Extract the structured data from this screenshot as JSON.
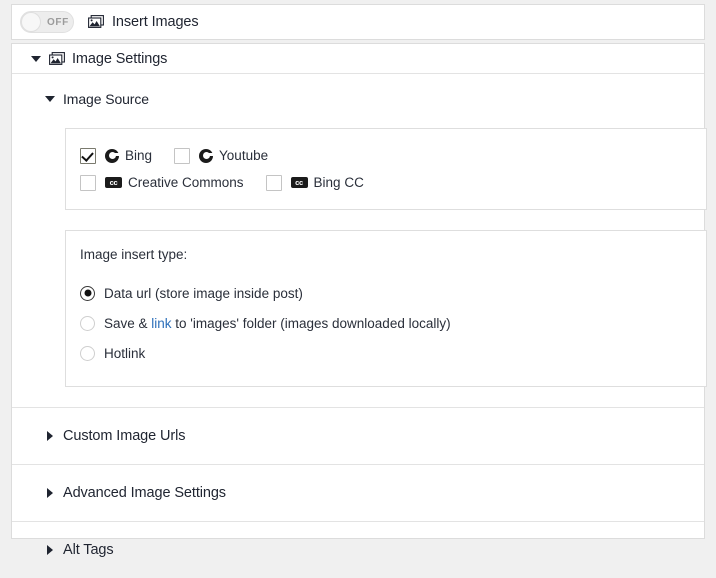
{
  "toggle": {
    "state_label": "OFF",
    "enabled": false,
    "icon": "image-icon",
    "title": "Insert Images"
  },
  "image_settings": {
    "title": "Image Settings",
    "icon": "image-icon",
    "expanded": true,
    "caret": "caret-down-icon"
  },
  "image_source": {
    "title": "Image Source",
    "expanded": true,
    "caret": "caret-down-icon",
    "sources": [
      {
        "label": "Bing",
        "checked": true,
        "icon": "bing-circle-icon"
      },
      {
        "label": "Youtube",
        "checked": false,
        "icon": "youtube-circle-icon"
      },
      {
        "label": "Creative Commons",
        "checked": false,
        "icon": "cc-badge-icon",
        "badge_text": "cc"
      },
      {
        "label": "Bing CC",
        "checked": false,
        "icon": "cc-badge-icon",
        "badge_text": "cc"
      }
    ],
    "insert_type": {
      "label": "Image insert type:",
      "options": [
        {
          "label": "Data url (store image inside post)",
          "selected": true
        },
        {
          "label_prefix": "Save & ",
          "label_link": "link",
          "label_suffix": " to 'images' folder (images downloaded locally)",
          "selected": false
        },
        {
          "label": "Hotlink",
          "selected": false
        }
      ]
    }
  },
  "collapsed_sections": [
    {
      "title": "Custom Image Urls",
      "expanded": false,
      "caret": "caret-right-icon"
    },
    {
      "title": "Advanced Image Settings",
      "expanded": false,
      "caret": "caret-right-icon"
    },
    {
      "title": "Alt Tags",
      "expanded": false,
      "caret": "caret-right-icon"
    }
  ],
  "colors": {
    "page_background": "#f0f0f0",
    "panel_background": "#ffffff",
    "border": "#dcdcdc",
    "text": "#1f2430",
    "muted_text": "#9b9b9b",
    "link": "#2c6fba",
    "icon_dark": "#1b1b1b"
  }
}
